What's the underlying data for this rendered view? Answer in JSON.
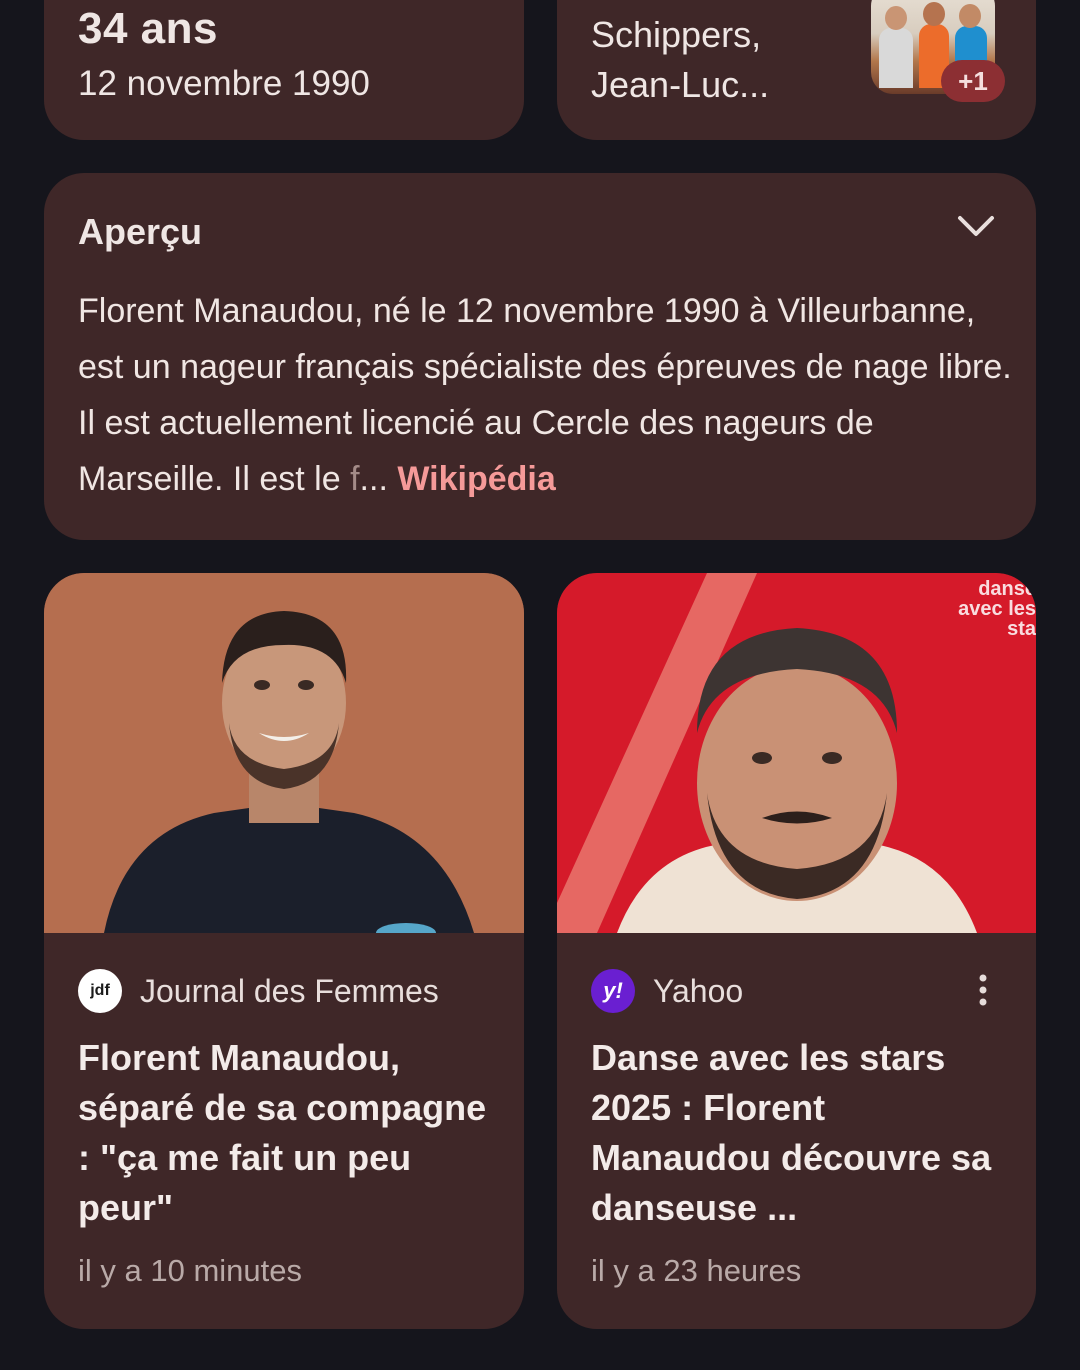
{
  "age_card": {
    "age": "34 ans",
    "birthdate": "12 novembre 1990"
  },
  "family_card": {
    "lines": [
      "",
      "Schippers,",
      "Jean-Luc..."
    ],
    "extra_count": "+1"
  },
  "overview": {
    "title": "Aperçu",
    "description": "Florent Manaudou, né le 12 novembre 1990 à Villeurbanne, est un nageur français spécialiste des épreuves de nage libre. Il est actuellement licencié au Cercle des nageurs de Marseille. Il est le ",
    "faded_char": "f",
    "ellipsis": "... ",
    "source": "Wikipédia",
    "icon": "chevron-down-icon"
  },
  "news": [
    {
      "source": "Journal des Femmes",
      "logo_text": "jdf",
      "headline": "Florent Manaudou, séparé de sa compagne : \"ça me fait un peu peur\"",
      "time": "il y a 10 minutes"
    },
    {
      "source": "Yahoo",
      "logo_text": "y!",
      "headline": "Danse avec les stars 2025 : Florent Manaudou découvre sa danseuse ...",
      "time": "il y a 23 heures",
      "watermark": "danse avec les sta"
    }
  ],
  "colors": {
    "background": "#15151c",
    "card": "#3f2728",
    "link": "#f59a99",
    "badge": "#8c2f33",
    "yahoo": "#6a1fd1"
  }
}
